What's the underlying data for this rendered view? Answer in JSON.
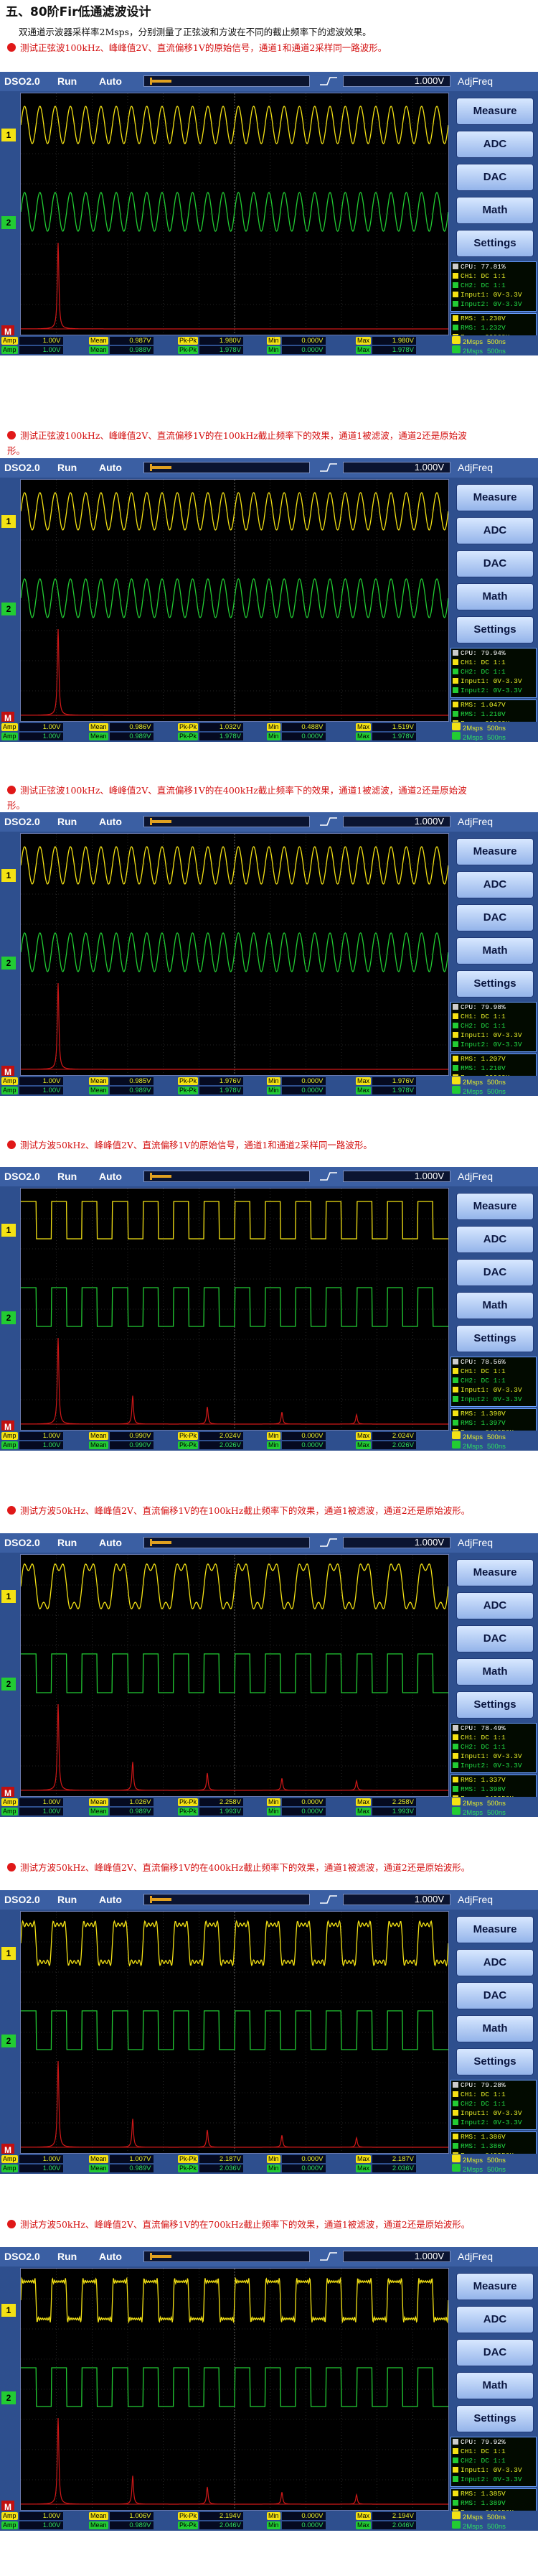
{
  "page": {
    "title": "五、80阶Fir低通滤波设计",
    "intro": "双通道示波器采样率2Msps，分别测量了正弦波和方波在不同的截止频率下的滤波效果。"
  },
  "scope_ui": {
    "app": "DSO2.0",
    "run": "Run",
    "auto": "Auto",
    "volt": "1.000V",
    "adjfreq": "AdjFreq",
    "buttons": [
      "Measure",
      "ADC",
      "DAC",
      "Math",
      "Settings"
    ],
    "sample": "2Msps",
    "sample_time": "500ns",
    "colors": {
      "ch1": "#f4e214",
      "ch2": "#22cc33",
      "math": "#d01818",
      "panel": "#2e4f8e"
    },
    "icons": {
      "edge": "rising-edge-icon",
      "trigger": "trigger-marker-icon"
    }
  },
  "captures": [
    {
      "caption": "测试正弦波100kHz、峰峰值2V、直流偏移1V的原始信号，通道1和通道2采样同一路波形。",
      "wave": "sine",
      "ch1_cycles": 28,
      "ch2_cycles": 28,
      "ch2_amp": 1.0,
      "spectrum_harmonics": false,
      "info": {
        "cpu": "CPU: 77.81%",
        "ch1": "CH1: DC 1:1",
        "ch2": "CH2: DC 1:1",
        "in1": "Input1: 0V-3.3V",
        "in2": "Input2: 0V-3.3V",
        "rms1": "RMS: 1.230V",
        "rms2": "RMS: 1.232V",
        "freq1": "Freq: 99960Hz",
        "freq2": "Freq: 000000Hz"
      },
      "row1": {
        "amp": "1.00V",
        "mean": "0.987V",
        "pkpk": "1.980V",
        "min": "0.000V",
        "max": "1.980V"
      },
      "row2": {
        "amp": "1.00V",
        "mean": "0.988V",
        "pkpk": "1.978V",
        "min": "0.000V",
        "max": "1.978V"
      }
    },
    {
      "caption": "测试正弦波100kHz、峰峰值2V、直流偏移1V的在100kHz截止频率下的效果，通道1被滤波，通道2还是原始波形。",
      "wave": "sine",
      "ch1_cycles": 28,
      "ch2_cycles": 28,
      "ch2_amp": 1.0,
      "spectrum_harmonics": false,
      "info": {
        "cpu": "CPU: 79.94%",
        "ch1": "CH1: DC 1:1",
        "ch2": "CH2: DC 1:1",
        "in1": "Input1: 0V-3.3V",
        "in2": "Input2: 0V-3.3V",
        "rms1": "RMS: 1.047V",
        "rms2": "RMS: 1.210V",
        "freq1": "Freq: 99960Hz",
        "freq2": "Freq: 000000Hz"
      },
      "row1": {
        "amp": "1.00V",
        "mean": "0.986V",
        "pkpk": "1.032V",
        "min": "0.488V",
        "max": "1.519V"
      },
      "row2": {
        "amp": "1.00V",
        "mean": "0.989V",
        "pkpk": "1.978V",
        "min": "0.000V",
        "max": "1.978V"
      }
    },
    {
      "caption": "测试正弦波100kHz、峰峰值2V、直流偏移1V的在400kHz截止频率下的效果，通道1被滤波，通道2还是原始波形。",
      "wave": "sine",
      "ch1_cycles": 28,
      "ch2_cycles": 28,
      "ch2_amp": 1.0,
      "spectrum_harmonics": false,
      "info": {
        "cpu": "CPU: 79.98%",
        "ch1": "CH1: DC 1:1",
        "ch2": "CH2: DC 1:1",
        "in1": "Input1: 0V-3.3V",
        "in2": "Input2: 0V-3.3V",
        "rms1": "RMS: 1.207V",
        "rms2": "RMS: 1.210V",
        "freq1": "Freq: 99960Hz",
        "freq2": "Freq: 000000Hz"
      },
      "row1": {
        "amp": "1.00V",
        "mean": "0.985V",
        "pkpk": "1.976V",
        "min": "0.000V",
        "max": "1.976V"
      },
      "row2": {
        "amp": "1.00V",
        "mean": "0.989V",
        "pkpk": "1.978V",
        "min": "0.000V",
        "max": "1.978V"
      }
    },
    {
      "caption": "测试方波50kHz、峰峰值2V、直流偏移1V的原始信号，通道1和通道2采样同一路波形。",
      "wave": "square",
      "ch1_cycles": 14,
      "ch2_cycles": 14,
      "ch2_amp": 1.0,
      "spectrum_harmonics": true,
      "info": {
        "cpu": "CPU: 78.56%",
        "ch1": "CH1: DC 1:1",
        "ch2": "CH2: DC 1:1",
        "in1": "Input1: 0V-3.3V",
        "in2": "Input2: 0V-3.3V",
        "rms1": "RMS: 1.390V",
        "rms2": "RMS: 1.397V",
        "freq1": "Freq: 049950Hz",
        "freq2": "Freq: 000000Hz"
      },
      "row1": {
        "amp": "1.00V",
        "mean": "0.990V",
        "pkpk": "2.024V",
        "min": "0.000V",
        "max": "2.024V"
      },
      "row2": {
        "amp": "1.00V",
        "mean": "0.990V",
        "pkpk": "2.026V",
        "min": "0.000V",
        "max": "2.026V"
      }
    },
    {
      "caption": "测试方波50kHz、峰峰值2V、直流偏移1V的在100kHz截止频率下的效果，通道1被滤波，通道2还是原始波形。",
      "wave": "square",
      "ch1_cycles": 14,
      "ch2_cycles": 14,
      "ch2_amp": 1.0,
      "spectrum_harmonics": true,
      "info": {
        "cpu": "CPU: 78.49%",
        "ch1": "CH1: DC 1:1",
        "ch2": "CH2: DC 1:1",
        "in1": "Input1: 0V-3.3V",
        "in2": "Input2: 0V-3.3V",
        "rms1": "RMS: 1.337V",
        "rms2": "RMS: 1.398V",
        "freq1": "Freq: 049950Hz",
        "freq2": "Freq: 000000Hz"
      },
      "row1": {
        "amp": "1.00V",
        "mean": "1.026V",
        "pkpk": "2.258V",
        "min": "0.000V",
        "max": "2.258V"
      },
      "row2": {
        "amp": "1.00V",
        "mean": "0.989V",
        "pkpk": "1.993V",
        "min": "0.000V",
        "max": "1.993V"
      }
    },
    {
      "caption": "测试方波50kHz、峰峰值2V、直流偏移1V的在400kHz截止频率下的效果，通道1被滤波，通道2还是原始波形。",
      "wave": "square",
      "ch1_cycles": 14,
      "ch2_cycles": 14,
      "ch2_amp": 1.0,
      "spectrum_harmonics": true,
      "info": {
        "cpu": "CPU: 79.28%",
        "ch1": "CH1: DC 1:1",
        "ch2": "CH2: DC 1:1",
        "in1": "Input1: 0V-3.3V",
        "in2": "Input2: 0V-3.3V",
        "rms1": "RMS: 1.386V",
        "rms2": "RMS: 1.386V",
        "freq1": "Freq: 049950Hz",
        "freq2": "Freq: 000000Hz"
      },
      "row1": {
        "amp": "1.00V",
        "mean": "1.007V",
        "pkpk": "2.187V",
        "min": "0.000V",
        "max": "2.187V"
      },
      "row2": {
        "amp": "1.00V",
        "mean": "0.989V",
        "pkpk": "2.036V",
        "min": "0.000V",
        "max": "2.036V"
      }
    },
    {
      "caption": "测试方波50kHz、峰峰值2V、直流偏移1V的在700kHz截止频率下的效果，通道1被滤波，通道2还是原始波形。",
      "wave": "square",
      "ch1_cycles": 14,
      "ch2_cycles": 14,
      "ch2_amp": 1.0,
      "spectrum_harmonics": true,
      "info": {
        "cpu": "CPU: 79.92%",
        "ch1": "CH1: DC 1:1",
        "ch2": "CH2: DC 1:1",
        "in1": "Input1: 0V-3.3V",
        "in2": "Input2: 0V-3.3V",
        "rms1": "RMS: 1.385V",
        "rms2": "RMS: 1.389V",
        "freq1": "Freq: 049950Hz",
        "freq2": "Freq: 000000Hz"
      },
      "row1": {
        "amp": "1.00V",
        "mean": "1.006V",
        "pkpk": "2.194V",
        "min": "0.000V",
        "max": "2.194V"
      },
      "row2": {
        "amp": "1.00V",
        "mean": "0.989V",
        "pkpk": "2.046V",
        "min": "0.000V",
        "max": "2.046V"
      }
    }
  ]
}
